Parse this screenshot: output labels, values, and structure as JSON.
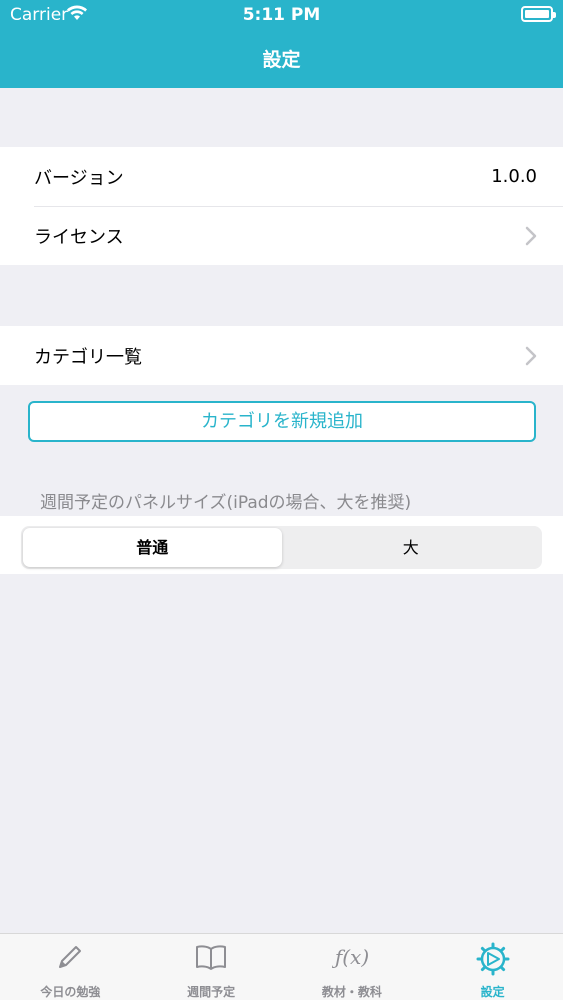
{
  "status_bar": {
    "carrier": "Carrier",
    "time": "5:11 PM"
  },
  "nav": {
    "title": "設定"
  },
  "info_group": {
    "rows": [
      {
        "label": "バージョン",
        "value": "1.0.0"
      },
      {
        "label": "ライセンス"
      }
    ]
  },
  "category_group": {
    "rows": [
      {
        "label": "カテゴリ一覧"
      }
    ]
  },
  "add_category_button": "カテゴリを新規追加",
  "panel_size": {
    "section_label": "週間予定のパネルサイズ(iPadの場合、大を推奨)",
    "options": [
      "普通",
      "大"
    ],
    "selected": "普通"
  },
  "tab_bar": {
    "items": [
      {
        "label": "今日の勉強",
        "icon": "pencil-icon"
      },
      {
        "label": "週間予定",
        "icon": "book-icon"
      },
      {
        "label": "教材・教科",
        "icon": "function-icon"
      },
      {
        "label": "設定",
        "icon": "settings-gear-icon"
      }
    ],
    "active": "設定",
    "accent_color": "#29b4cb"
  }
}
